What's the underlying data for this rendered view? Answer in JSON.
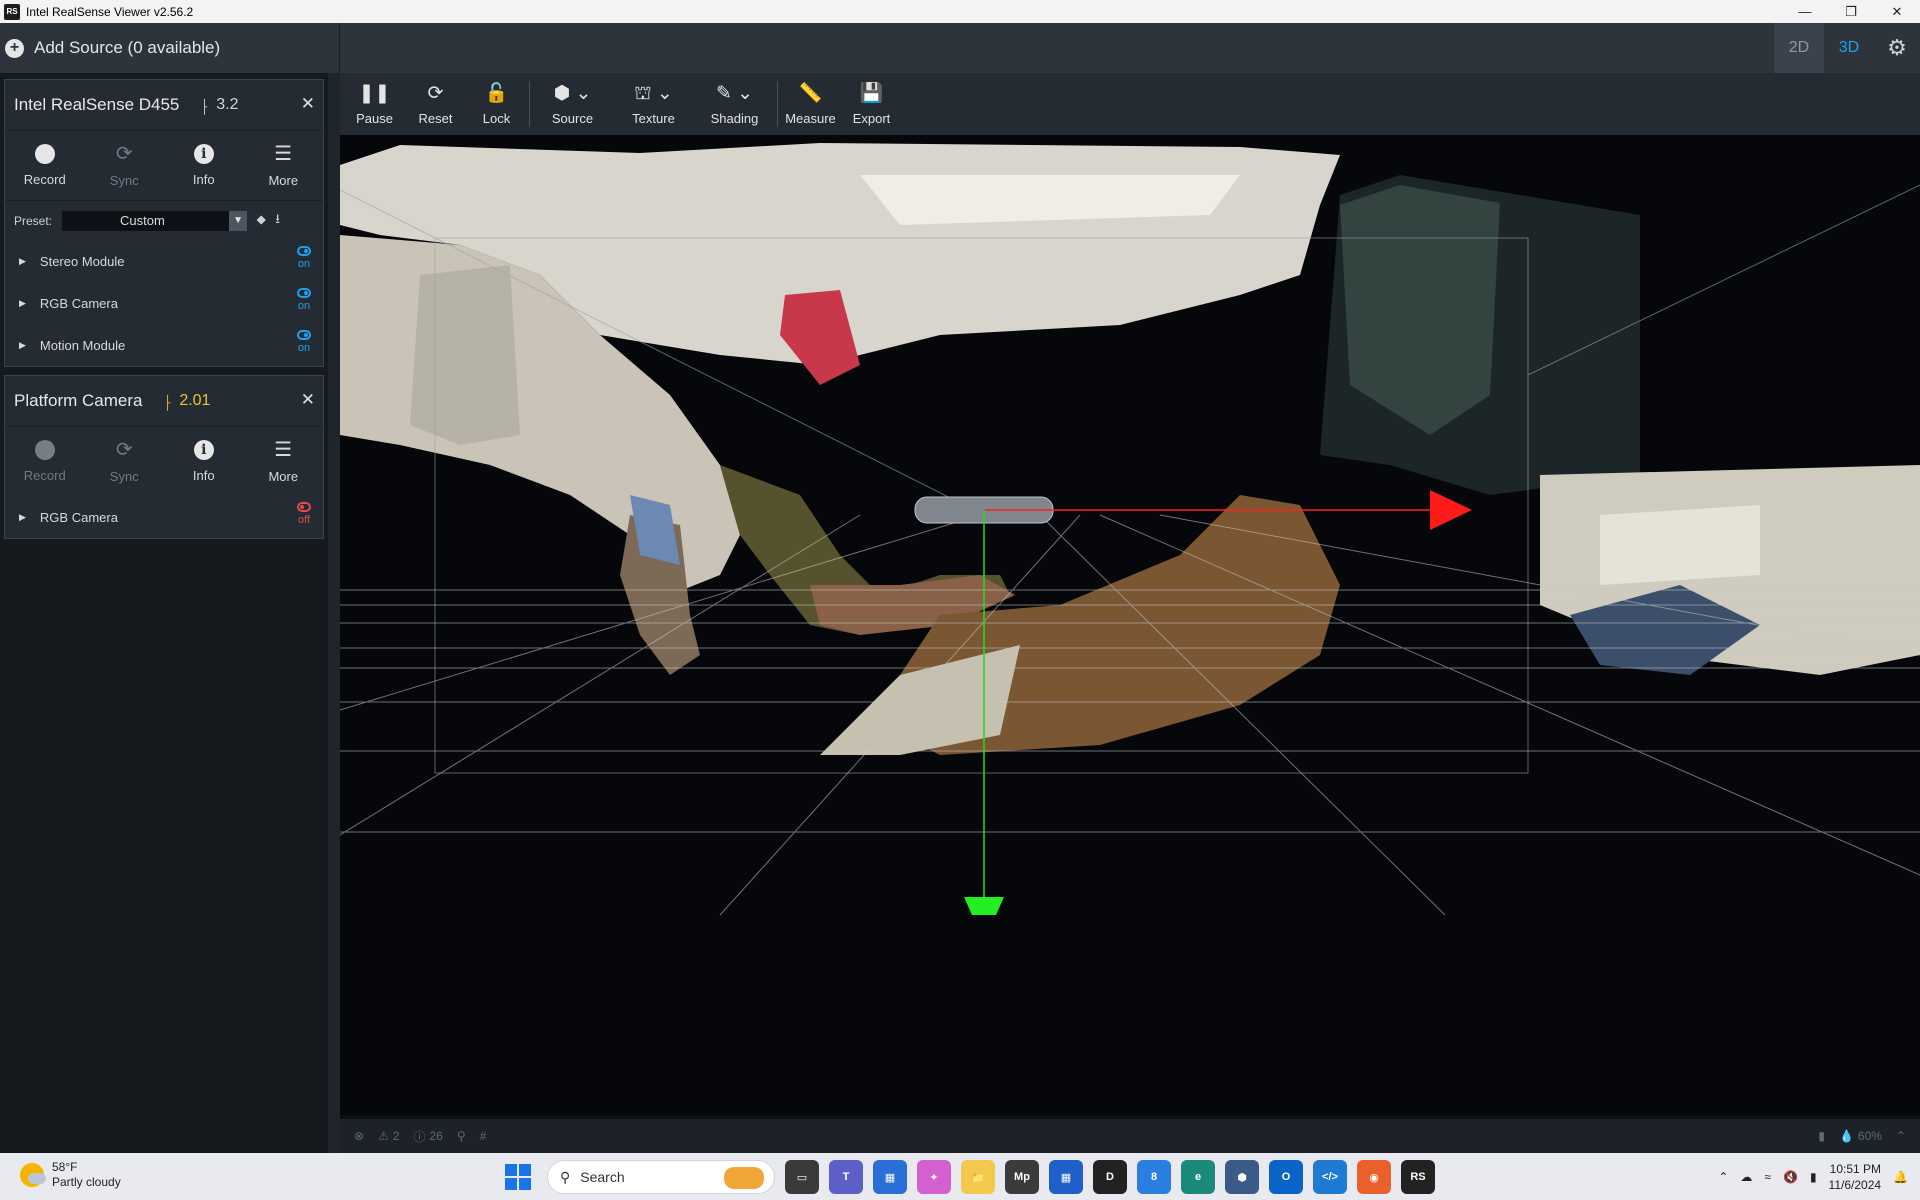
{
  "window": {
    "title": "Intel RealSense Viewer v2.56.2",
    "app_badge": "RS"
  },
  "header": {
    "add_source": "Add Source (0 available)",
    "view_2d": "2D",
    "view_3d": "3D",
    "active_view": "3D"
  },
  "devices": [
    {
      "name": "Intel RealSense D455",
      "usb": "3.2",
      "actions": [
        "Record",
        "Sync",
        "Info",
        "More"
      ],
      "preset_label": "Preset:",
      "preset_value": "Custom",
      "modules": [
        {
          "name": "Stereo Module",
          "state": "on"
        },
        {
          "name": "RGB Camera",
          "state": "on"
        },
        {
          "name": "Motion Module",
          "state": "on"
        }
      ]
    },
    {
      "name": "Platform Camera",
      "usb": "2.01",
      "actions": [
        "Record",
        "Sync",
        "Info",
        "More"
      ],
      "modules": [
        {
          "name": "RGB Camera",
          "state": "off"
        }
      ]
    }
  ],
  "toolbar": {
    "pause": "Pause",
    "reset": "Reset",
    "lock": "Lock",
    "source": "Source",
    "texture": "Texture",
    "shading": "Shading",
    "measure": "Measure",
    "export": "Export"
  },
  "statusbar": {
    "warnings": "2",
    "infos": "26",
    "filter": "#",
    "battery": "60%"
  },
  "taskbar": {
    "weather_temp": "58°F",
    "weather_desc": "Partly cloudy",
    "search_placeholder": "Search",
    "time": "10:51 PM",
    "date": "11/6/2024",
    "badge_count": "8"
  },
  "colors": {
    "accent": "#1ea1f2",
    "off": "#e24a4a",
    "usb2": "#f0c030",
    "axis_x": "#ff2020",
    "axis_y": "#22dd22"
  }
}
